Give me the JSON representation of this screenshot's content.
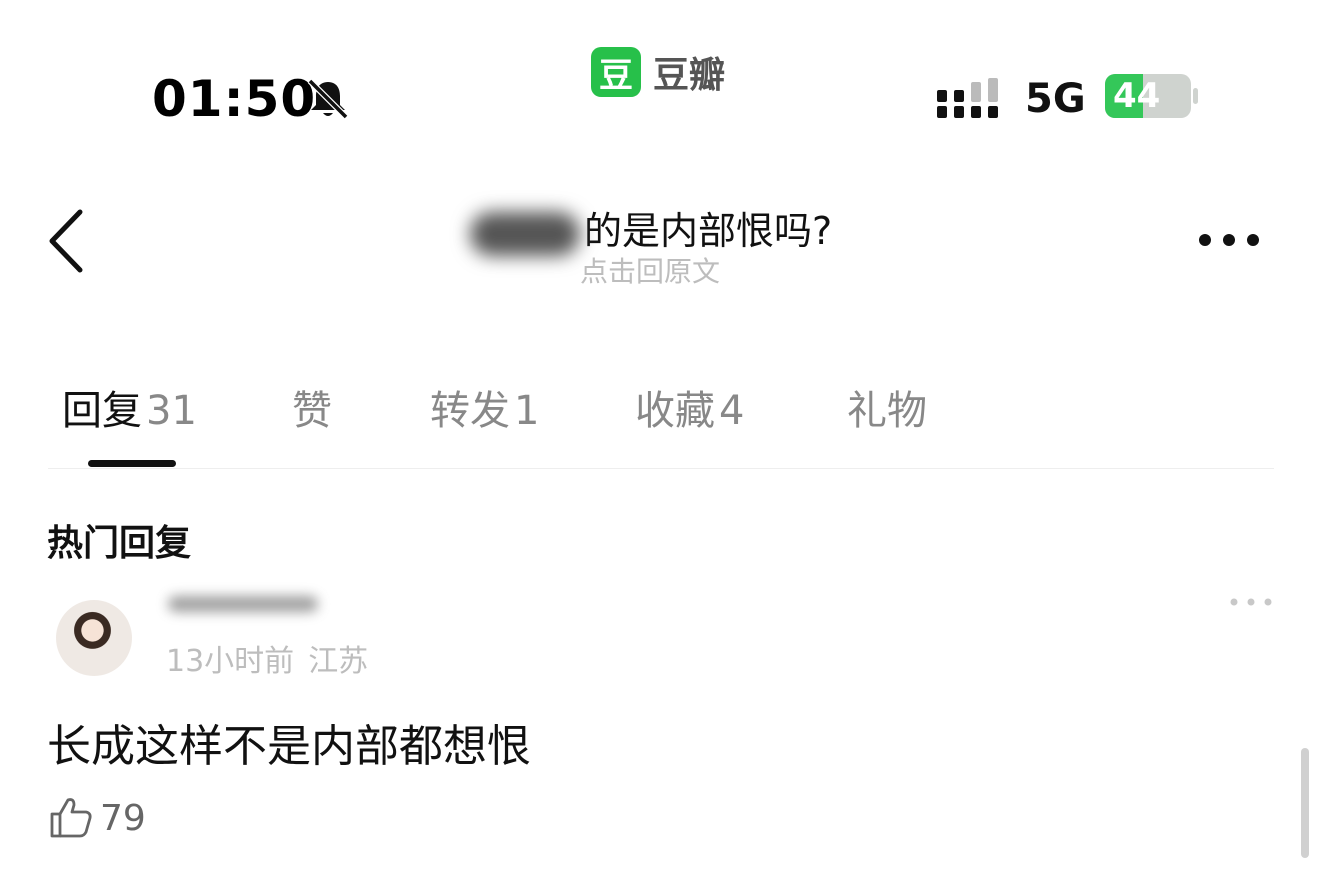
{
  "status_bar": {
    "time": "01:50",
    "app_logo_char": "豆",
    "app_name": "豆瓣",
    "network": "5G",
    "battery_percent": "44",
    "battery_level": 0.44,
    "icons": [
      "bell-muted-icon",
      "signal-icon",
      "battery-icon"
    ]
  },
  "nav": {
    "title": "的是内部恨吗?",
    "subtitle": "点击回原文",
    "icons": [
      "back-chevron-icon",
      "more-icon"
    ]
  },
  "tabs": [
    {
      "label": "回复",
      "count": "31",
      "active": true
    },
    {
      "label": "赞",
      "count": ""
    },
    {
      "label": "转发",
      "count": "1"
    },
    {
      "label": "收藏",
      "count": "4"
    },
    {
      "label": "礼物",
      "count": ""
    }
  ],
  "section": {
    "title": "热门回复"
  },
  "comment": {
    "time_ago": "13小时前",
    "location": "江苏",
    "text": "长成这样不是内部都想恨",
    "likes": "79"
  },
  "colors": {
    "accent": "#27c04a",
    "battery": "#34c759",
    "muted_text": "#bdbdbd"
  }
}
